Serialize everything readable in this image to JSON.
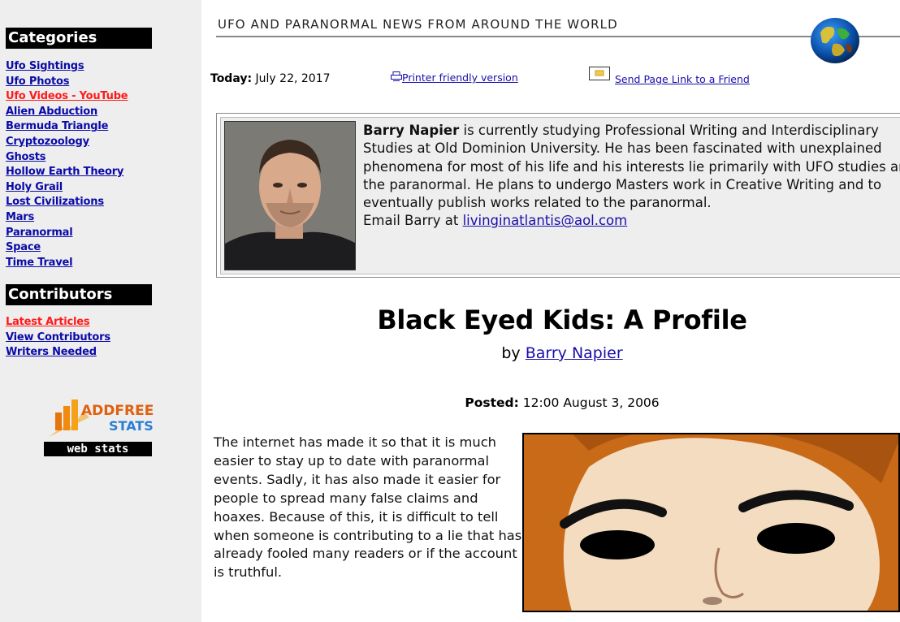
{
  "sidebar": {
    "categories_heading": "Categories",
    "categories": [
      {
        "label": "Ufo Sightings",
        "highlight": false
      },
      {
        "label": "Ufo Photos",
        "highlight": false
      },
      {
        "label": "Ufo Videos - YouTube",
        "highlight": true
      },
      {
        "label": "Alien Abduction",
        "highlight": false
      },
      {
        "label": "Bermuda Triangle",
        "highlight": false
      },
      {
        "label": "Cryptozoology",
        "highlight": false
      },
      {
        "label": "Ghosts",
        "highlight": false
      },
      {
        "label": "Hollow Earth Theory",
        "highlight": false
      },
      {
        "label": "Holy Grail",
        "highlight": false
      },
      {
        "label": "Lost Civilizations",
        "highlight": false
      },
      {
        "label": "Mars",
        "highlight": false
      },
      {
        "label": "Paranormal",
        "highlight": false
      },
      {
        "label": "Space",
        "highlight": false
      },
      {
        "label": "Time Travel",
        "highlight": false
      }
    ],
    "contributors_heading": "Contributors",
    "contributors": [
      {
        "label": "Latest Articles",
        "highlight": true
      },
      {
        "label": "View Contributors",
        "highlight": false
      },
      {
        "label": "Writers Needed",
        "highlight": false
      }
    ],
    "stats_badge": {
      "logo_line1": "ADDFREE",
      "logo_line2": "STATS",
      "label": "web stats"
    }
  },
  "header": {
    "site_title": "UFO AND PARANORMAL NEWS FROM AROUND THE WORLD"
  },
  "today_bar": {
    "today_label": "Today:",
    "date": "July 22, 2017",
    "printer_link": "Printer friendly version",
    "send_link": "Send Page Link to a Friend"
  },
  "bio": {
    "name": "Barry Napier",
    "text": " is currently studying Professional Writing and Interdisciplinary Studies at Old Dominion University. He has been fascinated with unexplained phenomena for most of his life and his interests lie primarily with UFO studies and the paranormal. He plans to undergo Masters work in Creative Writing and to eventually publish works related to the paranormal.",
    "email_prefix": "Email Barry at ",
    "email": "livinginatlantis@aol.com"
  },
  "article": {
    "title": "Black Eyed Kids: A Profile",
    "by": "by ",
    "author": "Barry Napier",
    "posted_label": "Posted:",
    "posted_value": " 12:00 August 3, 2006",
    "body": "The internet has made it so that it is much easier to stay up to date with paranormal events. Sadly, it has also made it easier for people to spread many false claims and hoaxes. Because of this, it is difficult to tell when someone is contributing to a lie that has already fooled many readers or if the account is truthful."
  },
  "colors": {
    "link": "#0a0aa8",
    "link_highlight": "#ff1a1a",
    "sidebar_bg": "#eeeeee",
    "heading_bg": "#000000"
  }
}
